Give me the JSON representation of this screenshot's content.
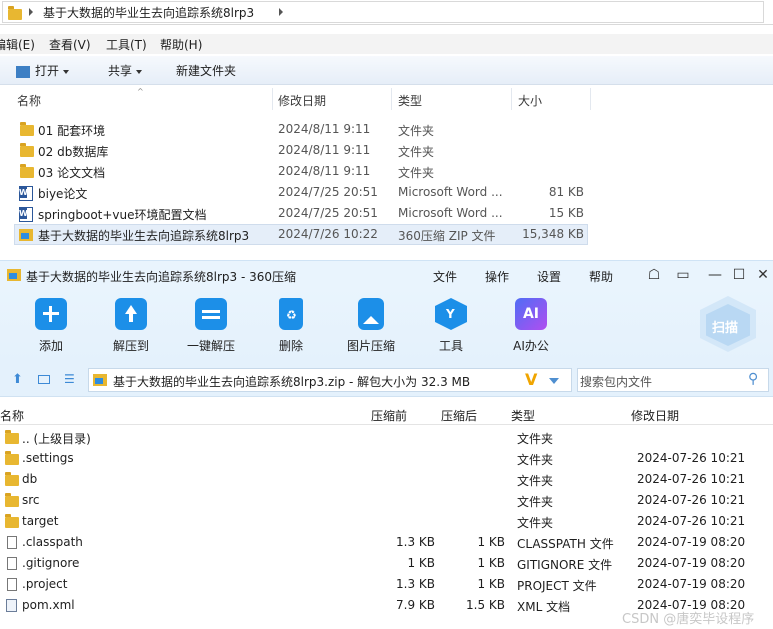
{
  "explorer": {
    "address": "基于大数据的毕业生去向追踪系统8lrp3",
    "menu": [
      "编辑(E)",
      "查看(V)",
      "工具(T)",
      "帮助(H)"
    ],
    "toolbar": {
      "open": "打开",
      "share": "共享",
      "new_folder": "新建文件夹"
    },
    "columns": {
      "name": "名称",
      "date": "修改日期",
      "type": "类型",
      "size": "大小"
    },
    "rows": [
      {
        "name": "01 配套环境",
        "date": "2024/8/11 9:11",
        "type": "文件夹",
        "size": "",
        "icon": "folder-icon"
      },
      {
        "name": "02 db数据库",
        "date": "2024/8/11 9:11",
        "type": "文件夹",
        "size": "",
        "icon": "folder-icon"
      },
      {
        "name": "03 论文文档",
        "date": "2024/8/11 9:11",
        "type": "文件夹",
        "size": "",
        "icon": "folder-icon"
      },
      {
        "name": "biye论文",
        "date": "2024/7/25 20:51",
        "type": "Microsoft Word ...",
        "size": "81 KB",
        "icon": "word-doc-icon"
      },
      {
        "name": "springboot+vue环境配置文档",
        "date": "2024/7/25 20:51",
        "type": "Microsoft Word ...",
        "size": "15 KB",
        "icon": "word-doc-icon"
      },
      {
        "name": "基于大数据的毕业生去向追踪系统8lrp3",
        "date": "2024/7/26 10:22",
        "type": "360压缩 ZIP 文件",
        "size": "15,348 KB",
        "icon": "zip-archive-icon"
      }
    ]
  },
  "zip": {
    "title": "基于大数据的毕业生去向追踪系统8lrp3 - 360压缩",
    "menu": [
      "文件",
      "操作",
      "设置",
      "帮助"
    ],
    "tools": [
      "添加",
      "解压到",
      "一键解压",
      "删除",
      "图片压缩",
      "工具",
      "AI办公"
    ],
    "scan": "扫描",
    "path": "基于大数据的毕业生去向追踪系统8lrp3.zip - 解包大小为 32.3 MB",
    "search_placeholder": "搜索包内文件",
    "columns": {
      "name": "名称",
      "before": "压缩前",
      "after": "压缩后",
      "type": "类型",
      "date": "修改日期"
    },
    "rows": [
      {
        "name": ".. (上级目录)",
        "before": "",
        "after": "",
        "type": "文件夹",
        "date": "",
        "icon": "folder-icon"
      },
      {
        "name": ".settings",
        "before": "",
        "after": "",
        "type": "文件夹",
        "date": "2024-07-26 10:21",
        "icon": "folder-icon"
      },
      {
        "name": "db",
        "before": "",
        "after": "",
        "type": "文件夹",
        "date": "2024-07-26 10:21",
        "icon": "folder-icon"
      },
      {
        "name": "src",
        "before": "",
        "after": "",
        "type": "文件夹",
        "date": "2024-07-26 10:21",
        "icon": "folder-icon"
      },
      {
        "name": "target",
        "before": "",
        "after": "",
        "type": "文件夹",
        "date": "2024-07-26 10:21",
        "icon": "folder-icon"
      },
      {
        "name": ".classpath",
        "before": "1.3 KB",
        "after": "1 KB",
        "type": "CLASSPATH 文件",
        "date": "2024-07-19 08:20",
        "icon": "file-icon"
      },
      {
        "name": ".gitignore",
        "before": "1 KB",
        "after": "1 KB",
        "type": "GITIGNORE 文件",
        "date": "2024-07-19 08:20",
        "icon": "file-icon"
      },
      {
        "name": ".project",
        "before": "1.3 KB",
        "after": "1 KB",
        "type": "PROJECT 文件",
        "date": "2024-07-19 08:20",
        "icon": "file-icon"
      },
      {
        "name": "pom.xml",
        "before": "7.9 KB",
        "after": "1.5 KB",
        "type": "XML 文档",
        "date": "2024-07-19 08:20",
        "icon": "xml-file-icon"
      }
    ]
  },
  "watermark": "CSDN @唐奕毕设程序"
}
